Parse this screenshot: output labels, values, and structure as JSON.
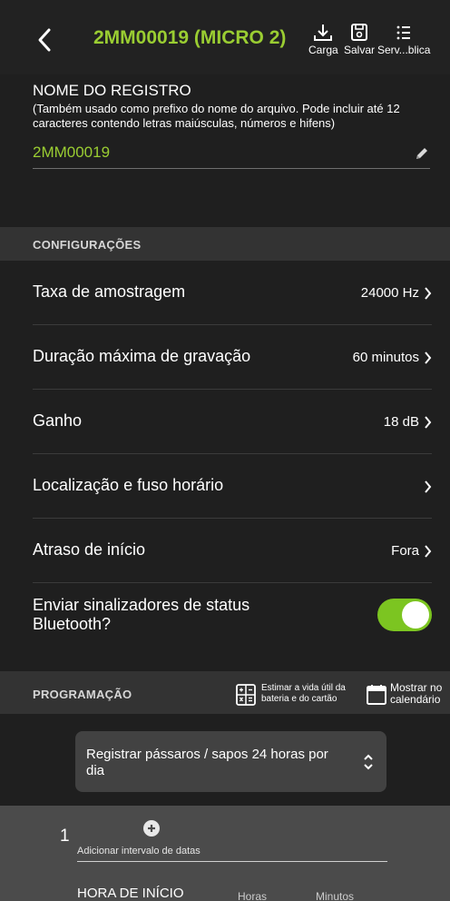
{
  "header": {
    "title": "2MM00019 (MICRO 2)",
    "actions": [
      {
        "label": "Carga",
        "icon": "download-icon"
      },
      {
        "label": "Salvar",
        "icon": "save-icon"
      },
      {
        "label": "Serv...blica",
        "icon": "list-icon"
      }
    ],
    "back_icon": "chevron-left-icon"
  },
  "registro": {
    "title": "NOME DO REGISTRO",
    "help": "(Também usado como prefixo do nome do arquivo. Pode incluir até 12 caracteres contendo letras maiúsculas, números e hifens)",
    "value": "2MM00019",
    "edit_icon": "pencil-icon"
  },
  "configuracoes": {
    "title": "CONFIGURAÇÕES",
    "rows": [
      {
        "label": "Taxa de amostragem",
        "value": "24000 Hz"
      },
      {
        "label": "Duração máxima de gravação",
        "value": "60 minutos"
      },
      {
        "label": "Ganho",
        "value": "18 dB"
      },
      {
        "label": "Localização e fuso horário",
        "value": ""
      },
      {
        "label": "Atraso de início",
        "value": "Fora"
      }
    ],
    "bluetooth": {
      "label": "Enviar sinalizadores de status Bluetooth?",
      "enabled": true
    }
  },
  "programacao": {
    "title": "PROGRAMAÇÃO",
    "estimate_label": "Estimar a vida útil da bateria e do cartão",
    "estimate_line1": "Estimar a vida útil da",
    "estimate_line2": "bateria e do cartão",
    "calendar_line1": "Mostrar no",
    "calendar_line2": "calendário",
    "preset": "Registrar pássaros / sapos 24 horas por dia"
  },
  "date_range": {
    "number": "1",
    "add_label": "Adicionar intervalo de datas",
    "start_label": "HORA DE INÍCIO",
    "col_hours": "Horas",
    "col_minutes": "Minutos"
  },
  "colors": {
    "accent": "#9acd32",
    "toggle_on": "#7cc521",
    "background": "#1f1f1f"
  }
}
